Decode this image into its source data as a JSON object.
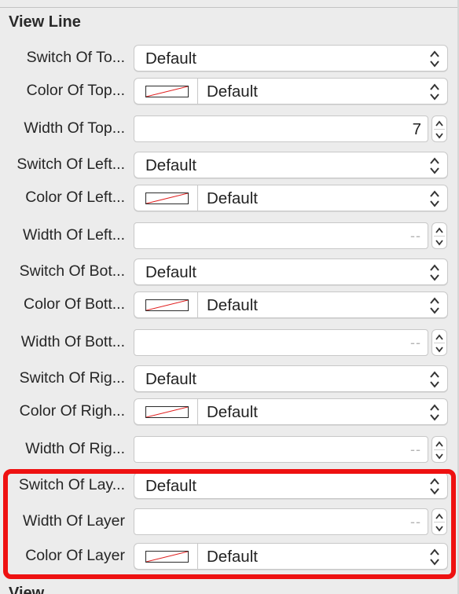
{
  "section": {
    "title": "View Line",
    "next_title": "View"
  },
  "colors": {
    "highlight": "#ee1111",
    "swatch_slash": "#e02020"
  },
  "rows": [
    {
      "type": "select",
      "label": "Switch Of To...",
      "value": "Default"
    },
    {
      "type": "color",
      "label": "Color Of Top...",
      "value": "Default"
    },
    {
      "type": "number",
      "label": "Width Of Top...",
      "value": "7",
      "placeholder": ""
    },
    {
      "type": "select",
      "label": "Switch Of Left...",
      "value": "Default"
    },
    {
      "type": "color",
      "label": "Color Of Left...",
      "value": "Default"
    },
    {
      "type": "number",
      "label": "Width Of Left...",
      "value": "",
      "placeholder": "--"
    },
    {
      "type": "select",
      "label": "Switch Of Bot...",
      "value": "Default"
    },
    {
      "type": "color",
      "label": "Color Of Bott...",
      "value": "Default"
    },
    {
      "type": "number",
      "label": "Width Of Bott...",
      "value": "",
      "placeholder": "--"
    },
    {
      "type": "select",
      "label": "Switch Of Rig...",
      "value": "Default"
    },
    {
      "type": "color",
      "label": "Color Of Righ...",
      "value": "Default"
    },
    {
      "type": "number",
      "label": "Width Of Rig...",
      "value": "",
      "placeholder": "--"
    },
    {
      "type": "select",
      "label": "Switch Of Lay...",
      "value": "Default"
    },
    {
      "type": "number",
      "label": "Width Of Layer",
      "value": "",
      "placeholder": "--"
    },
    {
      "type": "color",
      "label": "Color Of Layer",
      "value": "Default"
    }
  ]
}
